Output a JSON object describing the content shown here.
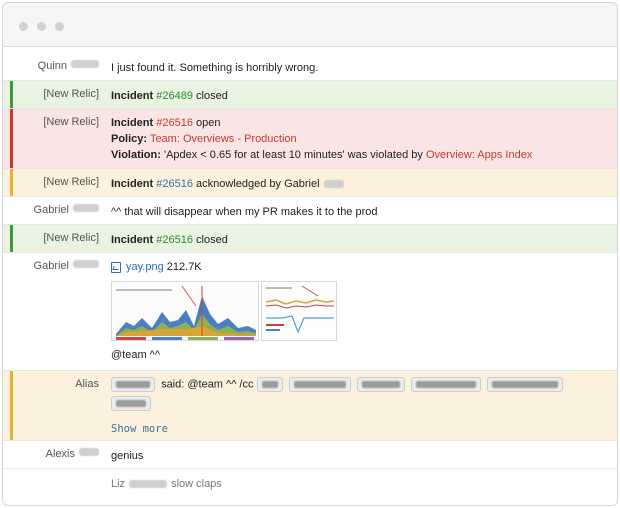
{
  "messages": [
    {
      "sender": "Quinn",
      "text": "I just found it. Something is horribly wrong."
    },
    {
      "sender": "[New Relic]",
      "incident_label": "Incident",
      "incident_num": "#26489",
      "status": "closed"
    },
    {
      "sender": "[New Relic]",
      "incident_label": "Incident",
      "incident_num": "#26516",
      "status": "open",
      "policy_label": "Policy",
      "policy_value": "Team: Overviews - Production",
      "violation_label": "Violation",
      "violation_text": "'Apdex < 0.65 for at least 10 minutes' was violated by",
      "violation_link": "Overview: Apps Index"
    },
    {
      "sender": "[New Relic]",
      "incident_label": "Incident",
      "incident_num": "#26516",
      "status": "acknowledged by Gabriel"
    },
    {
      "sender": "Gabriel",
      "text": "^^ that will disappear when my PR makes it to the prod"
    },
    {
      "sender": "[New Relic]",
      "incident_label": "Incident",
      "incident_num": "#26516",
      "status": "closed"
    },
    {
      "sender": "Gabriel",
      "file_name": "yay.png",
      "file_size": "212.7K",
      "caption": "@team ^^"
    },
    {
      "sender": "Alias",
      "said": "said: @team ^^ /cc",
      "show_more": "Show more"
    },
    {
      "sender": "Alexis",
      "text": "genius"
    },
    {
      "sender": "Liz",
      "text": "slow claps"
    }
  ],
  "colors": {
    "green_bg": "#e8f3e1",
    "green_accent": "#3f9a3f",
    "red_bg": "#f8e5e4",
    "red_accent": "#c43a33",
    "yellow_bg": "#fbf1dc",
    "yellow_accent": "#e5b234"
  }
}
